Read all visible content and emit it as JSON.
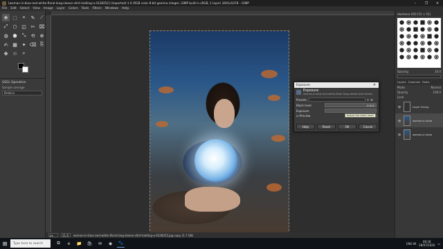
{
  "window": {
    "title": "[woman-in-blue-and-white-floral-long-sleeve-shirt-holding-a-4128252] (imported)-1.0 (RGB color 8-bit gamma integer, GIMP built-in sRGB, 1 layer) 3401x5478 – GIMP",
    "controls": [
      "–",
      "❐",
      "✕"
    ]
  },
  "menubar": [
    "File",
    "Edit",
    "Select",
    "View",
    "Image",
    "Layer",
    "Colors",
    "Tools",
    "Filters",
    "Windows",
    "Help"
  ],
  "toolbox": {
    "tools": [
      "✥",
      "⬚",
      "⌖",
      "✎",
      "⟋",
      "⤢",
      "⬡",
      "◫",
      "✂",
      "⌧",
      "◍",
      "⬟",
      "⤡",
      "⟲",
      "⊕",
      "✍",
      "▦",
      "✦",
      "⌫",
      "⎘",
      "✤",
      "☉",
      "⌕"
    ],
    "tool_options": {
      "header": "GEGL Operation",
      "sample_average": "Sample average",
      "mode_value": "Brakica"
    }
  },
  "dialog": {
    "window_title": "Exposure",
    "close": "✕",
    "heading": "Exposure",
    "subheading": "woman-in-blue-and-white-floral-long-sleeve-shirt-holding-a...",
    "presets_label": "Presets:",
    "black_level_label": "Black level",
    "black_level_value": "0.011",
    "exposure_label": "Exposure",
    "tooltip": "Adjust the black level",
    "preview_label": "Preview",
    "split_view_label": "Split view",
    "buttons": [
      "Help",
      "Reset",
      "OK",
      "Cancel"
    ]
  },
  "right_panel": {
    "brushes_title": "Hardness 050 (51 × 51)",
    "spacing_label": "Spacing",
    "spacing_value": "10.0",
    "tabs": [
      "Layers",
      "Channels",
      "Paths"
    ],
    "mode_label": "Mode",
    "mode_value": "Normal",
    "opacity_label": "Opacity",
    "opacity_value": "100.0",
    "lock_label": "Lock:",
    "layers": [
      "Layer Group",
      "woman-in-blue",
      "woman-in-blue"
    ]
  },
  "status": {
    "unit": "px",
    "zoom": "11.6",
    "message": "woman-in-blue-and-white-floral-long-sleeve-shirt-holding-a-4128252.jpg copy (1.7 GB)"
  },
  "taskbar": {
    "search_placeholder": "Type here to search",
    "apps": [
      "⧉",
      "e",
      "📁",
      "🛍",
      "✉",
      "◉",
      "🐾"
    ],
    "tray_lang": "ENG",
    "tray_region": "IN",
    "time": "06:18",
    "date": "28/07/2020"
  }
}
